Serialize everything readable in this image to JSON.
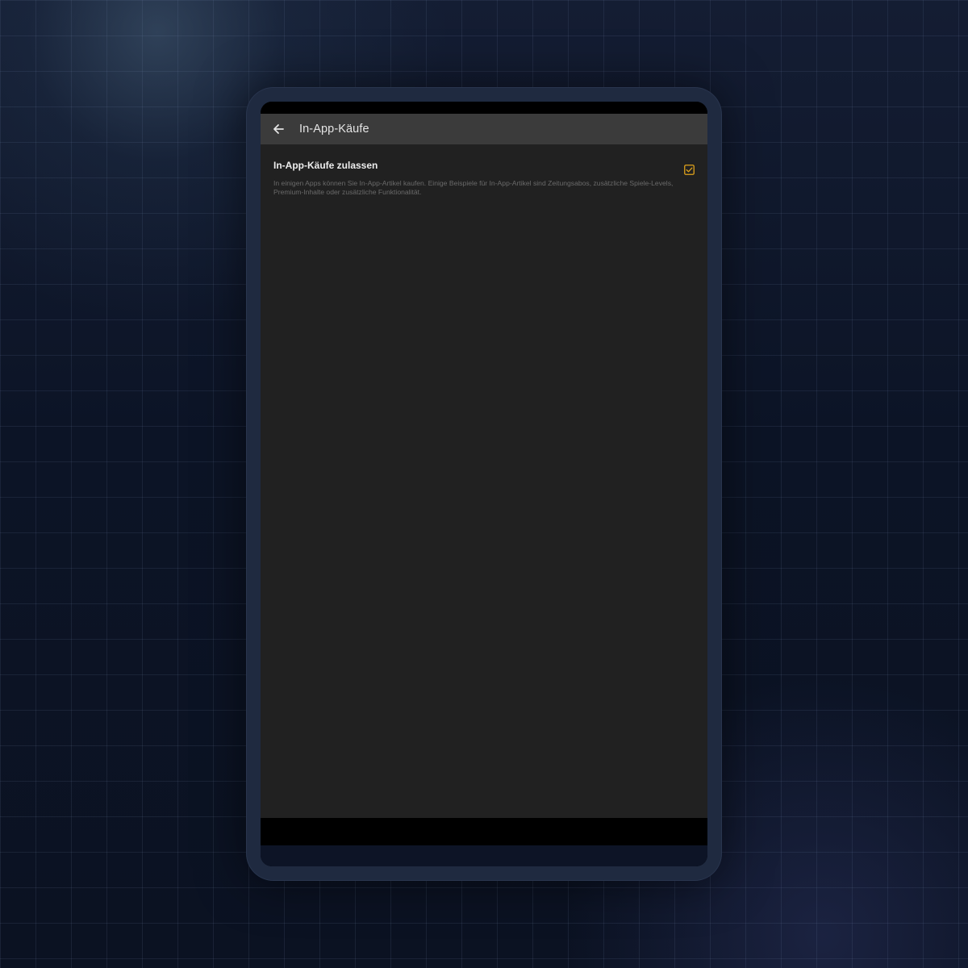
{
  "app_bar": {
    "title": "In-App-Käufe",
    "back_icon": "arrow-left-icon"
  },
  "setting": {
    "title": "In-App-Käufe zulassen",
    "description": "In einigen Apps können Sie In-App-Artikel kaufen. Einige Beispiele für In-App-Artikel sind Zeitungsabos, zusätzliche Spiele-Levels, Premium-Inhalte oder zusätzliche Funktionalität.",
    "checked": true,
    "checkbox_icon": "checkbox-checked-icon"
  },
  "colors": {
    "app_bar": "#3b3b3b",
    "content_background": "#212121",
    "accent": "#e0a21b",
    "device_frame": "#1f2a40",
    "page_background": "#0b1222"
  }
}
